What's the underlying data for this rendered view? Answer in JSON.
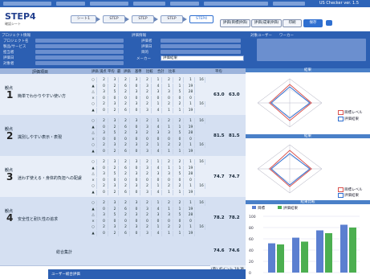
{
  "header": {
    "step_title": "STEP4",
    "step_sub": "確認シート",
    "nav": [
      {
        "label": "シート1"
      },
      {
        "label": "STEP"
      },
      {
        "label": "STEP"
      },
      {
        "label": "STEP"
      },
      {
        "label": "STEP4"
      }
    ],
    "right_buttons": [
      {
        "label": "評価(目標評価)"
      },
      {
        "label": "評価(成果評価)"
      },
      {
        "label": "印刷"
      },
      {
        "label": "保存"
      }
    ],
    "corner_label": "US Checker ver. 1.5"
  },
  "info": {
    "project_label": "プロジェクト情報",
    "project_fields": [
      "プロジェクト名",
      "製品/サービス",
      "担当者",
      "評価日",
      "対象者"
    ],
    "eval_label": "評価情報",
    "eval_fields": [
      "評価者",
      "評価日",
      "目的"
    ],
    "maker_label": "メーカー",
    "maker_value": "評価結果",
    "user_label": "対象ユーザー",
    "user_value": "ワーカー"
  },
  "table": {
    "header_title": "評価項目",
    "columns": [
      "評価",
      "満点",
      "平均",
      "最",
      "評価",
      "基準",
      "比較",
      "合計",
      "比率"
    ],
    "score_col": "平均",
    "sections": [
      {
        "num": "1",
        "label": "観点",
        "title": "簡単でわかりやすい使い方",
        "score1": "63.0",
        "score2": "63.0",
        "side": "入力/出力"
      },
      {
        "num": "2",
        "label": "観点",
        "title": "識別しやすい表示・表現",
        "score1": "81.5",
        "score2": "81.5",
        "side": "入力/出力"
      },
      {
        "num": "3",
        "label": "観点",
        "title": "迷わず使える・身体的負担への配慮",
        "score1": "74.7",
        "score2": "74.7",
        "side": "入力/出力"
      },
      {
        "num": "4",
        "label": "観点",
        "title": "安全性と耐久性の追求",
        "score1": "78.2",
        "score2": "78.2",
        "side": "入力/出力"
      }
    ],
    "total_label": "総合集計",
    "total_score1": "74.6",
    "total_score2": "74.6",
    "total_side": "入力/出力",
    "footer_note": "(参) ポイント",
    "footer_value": "19 項",
    "bottom_label": "ユーザー総合評価"
  },
  "right": {
    "radar_title1": "結果",
    "radar_title2": "結果",
    "bar_title": "結果比較",
    "legend": [
      "目標レベル",
      "評価結果"
    ],
    "bar_legend": [
      "目標",
      "評価結果"
    ],
    "bar_values": [
      52,
      50,
      62,
      55,
      75,
      70,
      85,
      80
    ],
    "bar_axis": [
      "100",
      "80",
      "60",
      "40",
      "20",
      "0"
    ],
    "colors": {
      "target": "#d9534f",
      "result": "#2f6fd0",
      "bar1": "#5b7fd0",
      "bar2": "#4caf50"
    }
  },
  "rows": [
    [
      "○",
      "2",
      "3",
      "2",
      "3",
      "2",
      "1",
      "2",
      "2",
      "1",
      "16"
    ],
    [
      "▲",
      "0",
      "2",
      "6",
      "0",
      "3",
      "4",
      "1",
      "1",
      "19"
    ],
    [
      "△",
      "3",
      "5",
      "2",
      "3",
      "2",
      "3",
      "3",
      "5",
      "28"
    ],
    [
      "×",
      "0",
      "0",
      "0",
      "0",
      "0",
      "0",
      "0",
      "0",
      "0"
    ]
  ]
}
